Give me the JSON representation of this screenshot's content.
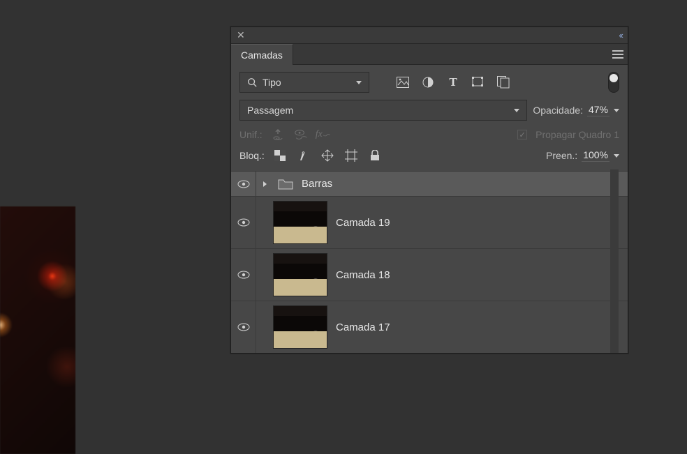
{
  "panel": {
    "tab_title": "Camadas",
    "filter_label": "Tipo",
    "blend_mode": "Passagem",
    "opacity": {
      "label": "Opacidade:",
      "value": "47%"
    },
    "unify": {
      "label": "Unif.:",
      "propagate_label": "Propagar Quadro 1"
    },
    "lock": "Bloq.:",
    "fill": {
      "label": "Preen.:",
      "value": "100%"
    },
    "filter_icons": [
      "image-icon",
      "adjustment-icon",
      "type-icon",
      "shape-icon",
      "smartobject-icon"
    ]
  },
  "layers": [
    {
      "type": "group",
      "name": "Barras",
      "selected": true,
      "visible": true
    },
    {
      "type": "layer",
      "name": "Camada 19",
      "visible": true
    },
    {
      "type": "layer",
      "name": "Camada 18",
      "visible": true
    },
    {
      "type": "layer",
      "name": "Camada 17",
      "visible": true
    }
  ]
}
